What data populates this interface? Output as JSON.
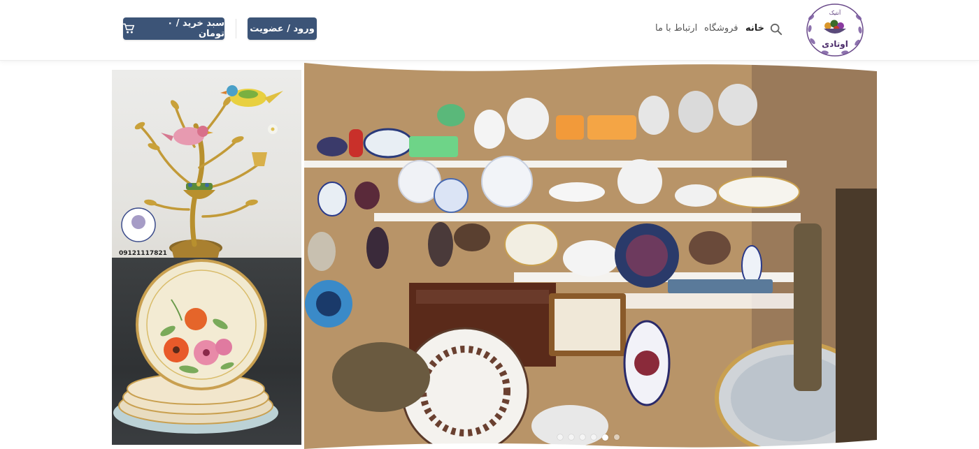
{
  "header": {
    "cart_button": {
      "label": "سبد خرید / ۰ تومان",
      "icon": "cart-icon"
    },
    "login_button": {
      "label": "ورود / عضویت"
    },
    "nav": [
      {
        "id": "home",
        "label": "خانه",
        "active": true
      },
      {
        "id": "shop",
        "label": "فروشگاه",
        "active": false
      },
      {
        "id": "contact",
        "label": "ارتباط با ما",
        "active": false
      }
    ],
    "search_icon": "search-icon",
    "logo": {
      "text_top": "آنتیک",
      "text_main": "اوتادی"
    }
  },
  "slider": {
    "phone_text": "09121117821",
    "dots": [
      false,
      false,
      false,
      false,
      true,
      false
    ],
    "active_index": 4
  },
  "colors": {
    "primary": "#3c5477",
    "nav_active": "#222222",
    "nav_text": "#555555",
    "logo_purple": "#6a4a8a"
  }
}
